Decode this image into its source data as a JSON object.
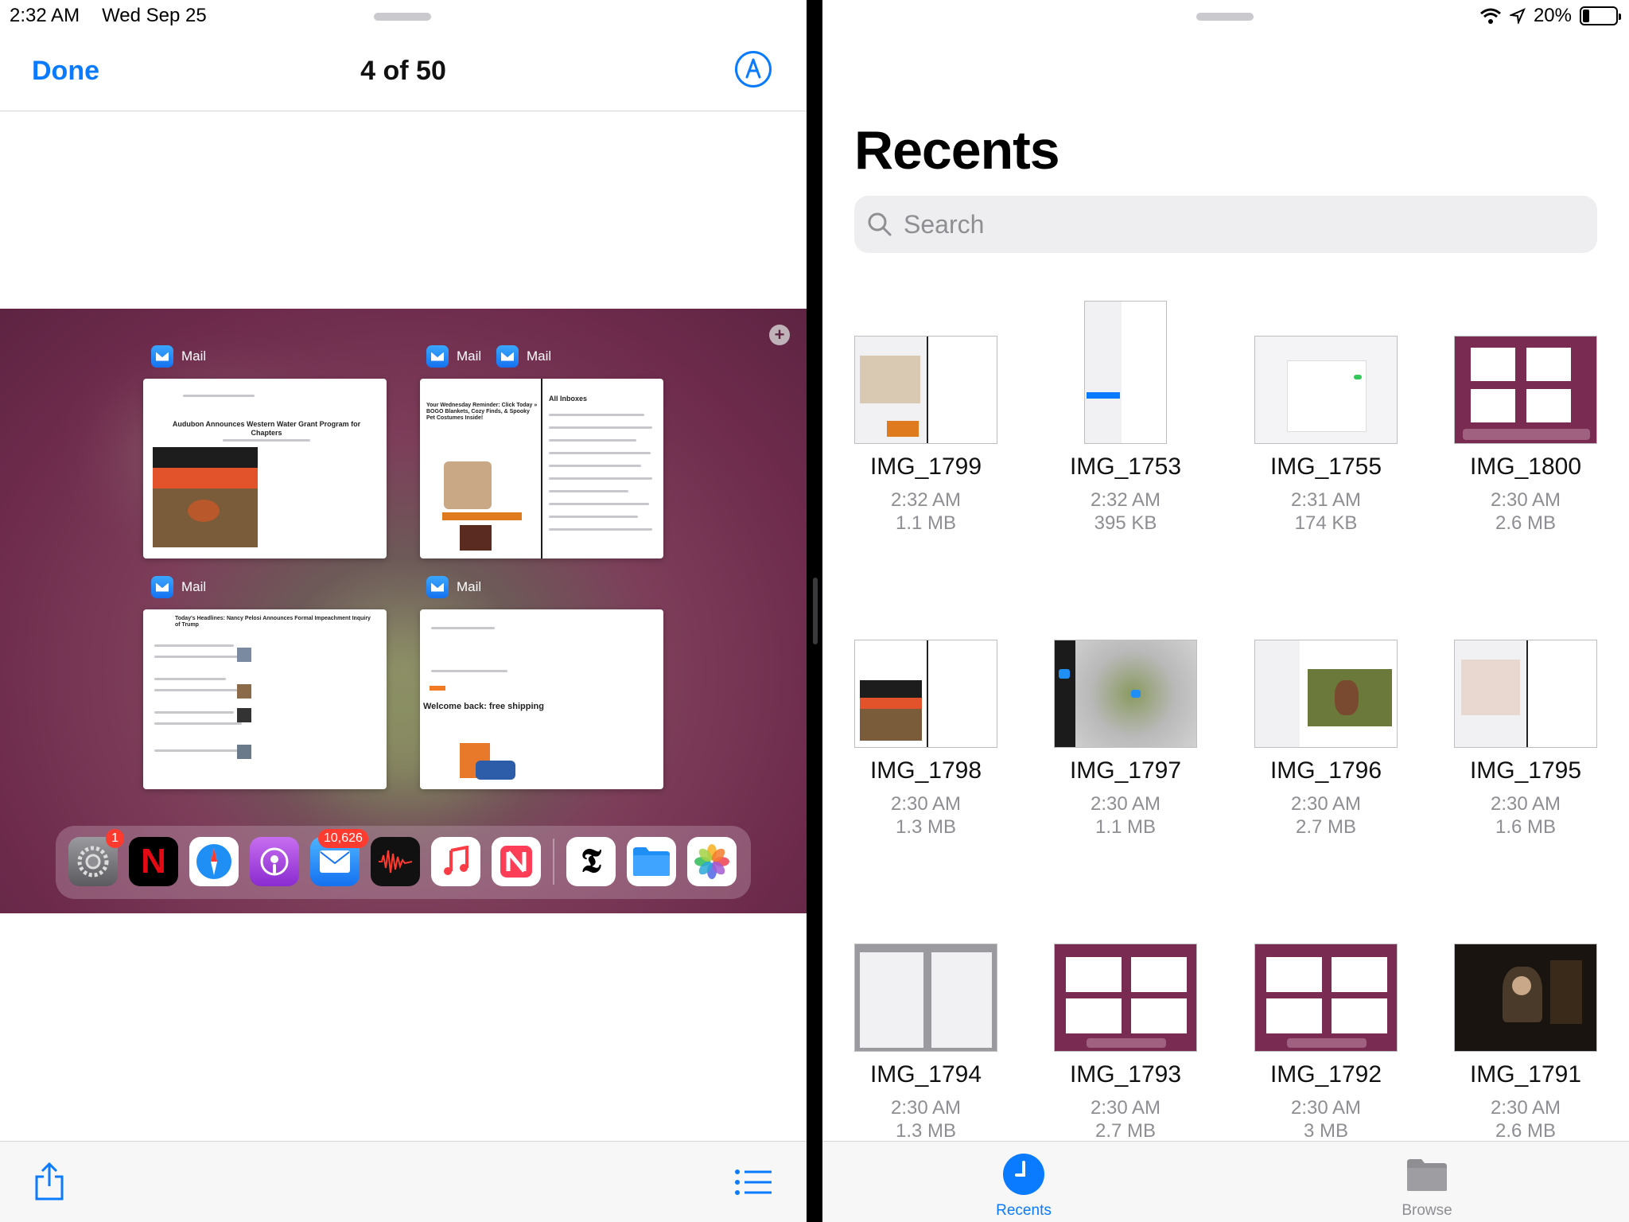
{
  "status_bar": {
    "time": "2:32 AM",
    "date": "Wed Sep 25",
    "battery": "20%"
  },
  "viewer": {
    "done_label": "Done",
    "counter": "4 of 50",
    "screenshot": {
      "app_name": "Mail",
      "card_headlines": [
        "Audubon Announces Western Water Grant Program for Chapters",
        "Your Wednesday Reminder: Click Today » BOGO Blankets, Cozy Finds, & Spooky Pet Costumes Inside!",
        "All Inboxes",
        "Today's Headlines: Nancy Pelosi Announces Formal Impeachment Inquiry of Trump",
        "Welcome back: free shipping"
      ],
      "dock_apps": [
        "Settings",
        "Netflix",
        "Safari",
        "Podcasts",
        "Mail",
        "Voice Memos",
        "Music",
        "News",
        "NYTimes",
        "Files",
        "Photos"
      ],
      "settings_badge": "1",
      "mail_badge": "10,626"
    }
  },
  "files": {
    "title": "Recents",
    "search_placeholder": "Search",
    "items": [
      {
        "name": "IMG_1799",
        "time": "2:32 AM",
        "size": "1.1 MB"
      },
      {
        "name": "IMG_1753",
        "time": "2:32 AM",
        "size": "395 KB"
      },
      {
        "name": "IMG_1755",
        "time": "2:31 AM",
        "size": "174 KB"
      },
      {
        "name": "IMG_1800",
        "time": "2:30 AM",
        "size": "2.6 MB"
      },
      {
        "name": "IMG_1798",
        "time": "2:30 AM",
        "size": "1.3 MB"
      },
      {
        "name": "IMG_1797",
        "time": "2:30 AM",
        "size": "1.1 MB"
      },
      {
        "name": "IMG_1796",
        "time": "2:30 AM",
        "size": "2.7 MB"
      },
      {
        "name": "IMG_1795",
        "time": "2:30 AM",
        "size": "1.6 MB"
      },
      {
        "name": "IMG_1794",
        "time": "2:30 AM",
        "size": "1.3 MB"
      },
      {
        "name": "IMG_1793",
        "time": "2:30 AM",
        "size": "2.7 MB"
      },
      {
        "name": "IMG_1792",
        "time": "2:30 AM",
        "size": "3 MB"
      },
      {
        "name": "IMG_1791",
        "time": "2:30 AM",
        "size": "2.6 MB"
      }
    ],
    "tabs": [
      {
        "label": "Recents",
        "active": true
      },
      {
        "label": "Browse",
        "active": false
      }
    ]
  },
  "colors": {
    "accent": "#0a7aff",
    "wallpaper": "#6e2b4c",
    "badge": "#ff3b30"
  }
}
